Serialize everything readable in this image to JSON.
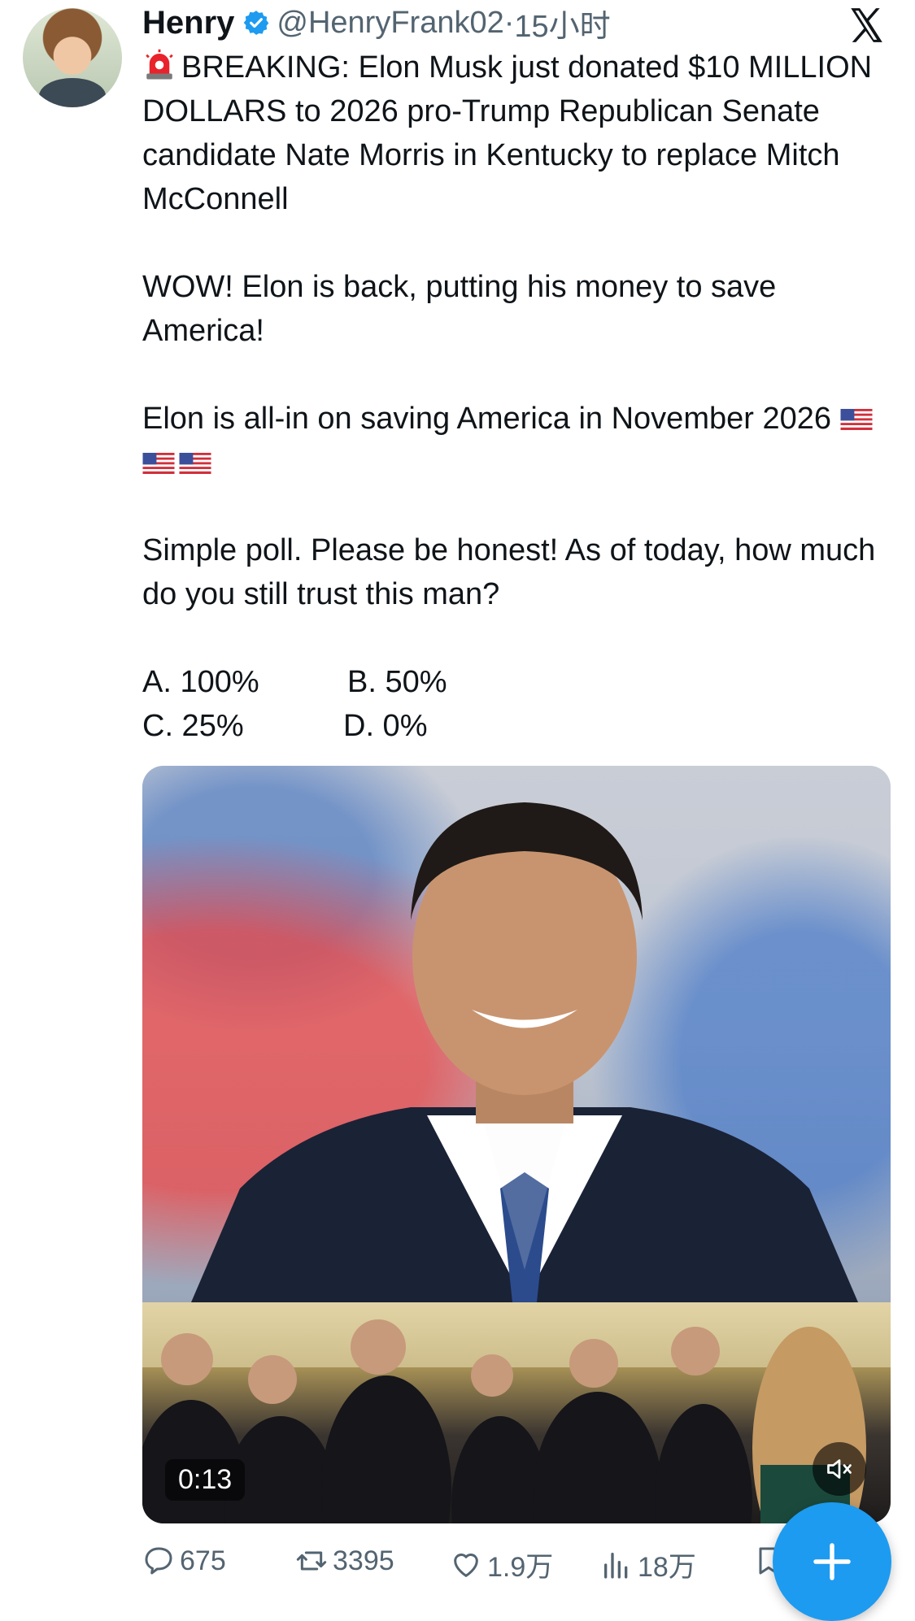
{
  "author": {
    "name": "Henry",
    "handle": "@HenryFrank02",
    "separator": "·",
    "time": "15小时"
  },
  "tweet": {
    "p1": "BREAKING: Elon Musk just donated $10 MILLION DOLLARS to 2026 pro-Trump Republican Senate candidate Nate Morris in Kentucky to replace Mitch McConnell",
    "p2": "WOW! Elon is back, putting his money to save America!",
    "p3": "Elon is all-in on saving America in November 2026",
    "p4": "Simple poll. Please be honest! As of today, how much do you still trust this man?",
    "options": [
      "A. 100%",
      "B. 50%",
      "C. 25%",
      "D. 0%"
    ]
  },
  "media": {
    "duration": "0:13"
  },
  "actions": {
    "replies": "675",
    "reposts": "3395",
    "likes": "1.9万",
    "views": "18万"
  },
  "colors": {
    "accent": "#1d9bf0",
    "secondary_text": "#536471"
  },
  "icons": [
    "verified-badge-icon",
    "x-logo-icon",
    "siren-emoji",
    "us-flag-emoji",
    "reply-icon",
    "repost-icon",
    "like-icon",
    "views-icon",
    "bookmark-icon",
    "mute-icon",
    "plus-icon"
  ]
}
